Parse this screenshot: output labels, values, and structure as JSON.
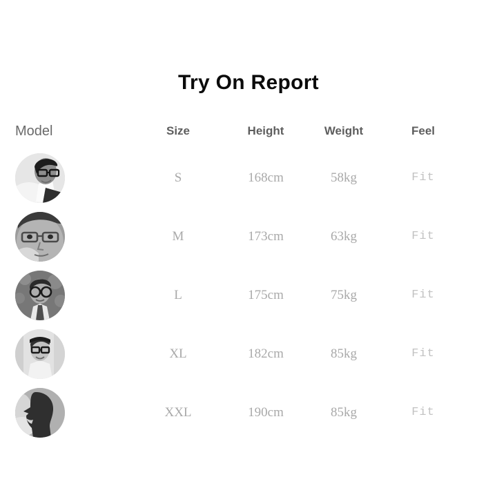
{
  "title": "Try On Report",
  "table": {
    "headers": {
      "model": "Model",
      "size": "Size",
      "height": "Height",
      "weight": "Weight",
      "feel": "Feel"
    },
    "rows": [
      {
        "model_alt": "model-photo-1",
        "size": "S",
        "height": "168cm",
        "weight": "58kg",
        "feel": "Fit"
      },
      {
        "model_alt": "model-photo-2",
        "size": "M",
        "height": "173cm",
        "weight": "63kg",
        "feel": "Fit"
      },
      {
        "model_alt": "model-photo-3",
        "size": "L",
        "height": "175cm",
        "weight": "75kg",
        "feel": "Fit"
      },
      {
        "model_alt": "model-photo-4",
        "size": "XL",
        "height": "182cm",
        "weight": "85kg",
        "feel": "Fit"
      },
      {
        "model_alt": "model-photo-5",
        "size": "XXL",
        "height": "190cm",
        "weight": "85kg",
        "feel": "Fit"
      }
    ]
  },
  "colors": {
    "background": "#ffffff",
    "title": "#0b0b0b",
    "header_text": "#5e5e5e",
    "body_text": "#a9a9a9",
    "feel_text": "#c2c2c2"
  }
}
